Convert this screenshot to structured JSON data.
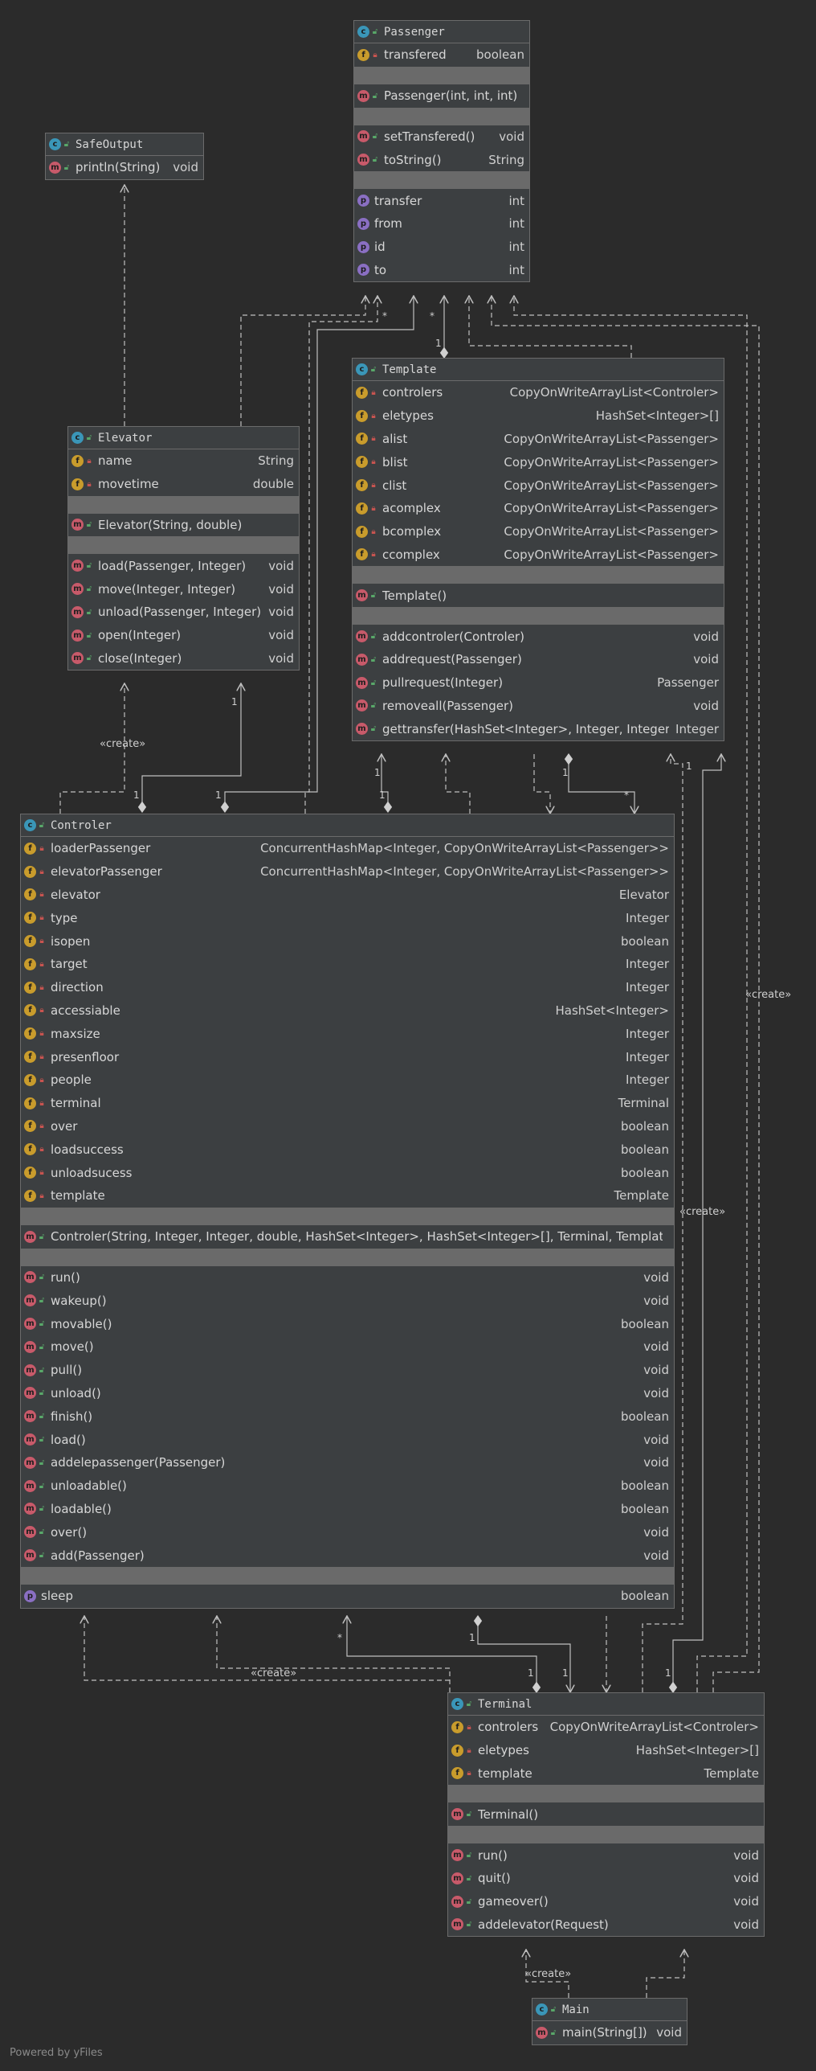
{
  "classes": {
    "passenger": {
      "name": "Passenger",
      "fields": [
        {
          "name": "transfered",
          "type": "boolean"
        }
      ],
      "constructors": [
        {
          "name": "Passenger(int, int, int)",
          "type": ""
        }
      ],
      "methods": [
        {
          "name": "setTransfered()",
          "type": "void"
        },
        {
          "name": "toString()",
          "type": "String"
        }
      ],
      "properties": [
        {
          "name": "transfer",
          "type": "int"
        },
        {
          "name": "from",
          "type": "int"
        },
        {
          "name": "id",
          "type": "int"
        },
        {
          "name": "to",
          "type": "int"
        }
      ]
    },
    "safeoutput": {
      "name": "SafeOutput",
      "methods": [
        {
          "name": "println(String)",
          "type": "void"
        }
      ]
    },
    "template": {
      "name": "Template",
      "fields": [
        {
          "name": "controlers",
          "type": "CopyOnWriteArrayList<Controler>"
        },
        {
          "name": "eletypes",
          "type": "HashSet<Integer>[]"
        },
        {
          "name": "alist",
          "type": "CopyOnWriteArrayList<Passenger>"
        },
        {
          "name": "blist",
          "type": "CopyOnWriteArrayList<Passenger>"
        },
        {
          "name": "clist",
          "type": "CopyOnWriteArrayList<Passenger>"
        },
        {
          "name": "acomplex",
          "type": "CopyOnWriteArrayList<Passenger>"
        },
        {
          "name": "bcomplex",
          "type": "CopyOnWriteArrayList<Passenger>"
        },
        {
          "name": "ccomplex",
          "type": "CopyOnWriteArrayList<Passenger>"
        }
      ],
      "constructors": [
        {
          "name": "Template()",
          "type": ""
        }
      ],
      "methods": [
        {
          "name": "addcontroler(Controler)",
          "type": "void"
        },
        {
          "name": "addrequest(Passenger)",
          "type": "void"
        },
        {
          "name": "pullrequest(Integer)",
          "type": "Passenger"
        },
        {
          "name": "removeall(Passenger)",
          "type": "void"
        },
        {
          "name": "gettransfer(HashSet<Integer>, Integer, Integer)",
          "type": "Integer"
        }
      ]
    },
    "elevator": {
      "name": "Elevator",
      "fields": [
        {
          "name": "name",
          "type": "String"
        },
        {
          "name": "movetime",
          "type": "double"
        }
      ],
      "constructors": [
        {
          "name": "Elevator(String, double)",
          "type": ""
        }
      ],
      "methods": [
        {
          "name": "load(Passenger, Integer)",
          "type": "void"
        },
        {
          "name": "move(Integer, Integer)",
          "type": "void"
        },
        {
          "name": "unload(Passenger, Integer)",
          "type": "void"
        },
        {
          "name": "open(Integer)",
          "type": "void"
        },
        {
          "name": "close(Integer)",
          "type": "void"
        }
      ]
    },
    "controler": {
      "name": "Controler",
      "fields": [
        {
          "name": "loaderPassenger",
          "type": "ConcurrentHashMap<Integer, CopyOnWriteArrayList<Passenger>>"
        },
        {
          "name": "elevatorPassenger",
          "type": "ConcurrentHashMap<Integer, CopyOnWriteArrayList<Passenger>>"
        },
        {
          "name": "elevator",
          "type": "Elevator"
        },
        {
          "name": "type",
          "type": "Integer"
        },
        {
          "name": "isopen",
          "type": "boolean"
        },
        {
          "name": "target",
          "type": "Integer"
        },
        {
          "name": "direction",
          "type": "Integer"
        },
        {
          "name": "accessiable",
          "type": "HashSet<Integer>"
        },
        {
          "name": "maxsize",
          "type": "Integer"
        },
        {
          "name": "presenfloor",
          "type": "Integer"
        },
        {
          "name": "people",
          "type": "Integer"
        },
        {
          "name": "terminal",
          "type": "Terminal"
        },
        {
          "name": "over",
          "type": "boolean"
        },
        {
          "name": "loadsuccess",
          "type": "boolean"
        },
        {
          "name": "unloadsucess",
          "type": "boolean"
        },
        {
          "name": "template",
          "type": "Template"
        }
      ],
      "constructors": [
        {
          "name": "Controler(String, Integer, Integer, double, HashSet<Integer>, HashSet<Integer>[], Terminal, Template)",
          "type": ""
        }
      ],
      "methods": [
        {
          "name": "run()",
          "type": "void"
        },
        {
          "name": "wakeup()",
          "type": "void"
        },
        {
          "name": "movable()",
          "type": "boolean"
        },
        {
          "name": "move()",
          "type": "void"
        },
        {
          "name": "pull()",
          "type": "void"
        },
        {
          "name": "unload()",
          "type": "void"
        },
        {
          "name": "finish()",
          "type": "boolean"
        },
        {
          "name": "load()",
          "type": "void"
        },
        {
          "name": "addelepassenger(Passenger)",
          "type": "void"
        },
        {
          "name": "unloadable()",
          "type": "boolean"
        },
        {
          "name": "loadable()",
          "type": "boolean"
        },
        {
          "name": "over()",
          "type": "void"
        },
        {
          "name": "add(Passenger)",
          "type": "void"
        }
      ],
      "properties": [
        {
          "name": "sleep",
          "type": "boolean"
        }
      ]
    },
    "terminal": {
      "name": "Terminal",
      "fields": [
        {
          "name": "controlers",
          "type": "CopyOnWriteArrayList<Controler>"
        },
        {
          "name": "eletypes",
          "type": "HashSet<Integer>[]"
        },
        {
          "name": "template",
          "type": "Template"
        }
      ],
      "constructors": [
        {
          "name": "Terminal()",
          "type": ""
        }
      ],
      "methods": [
        {
          "name": "run()",
          "type": "void"
        },
        {
          "name": "quit()",
          "type": "void"
        },
        {
          "name": "gameover()",
          "type": "void"
        },
        {
          "name": "addelevator(Request)",
          "type": "void"
        }
      ]
    },
    "main": {
      "name": "Main",
      "methods": [
        {
          "name": "main(String[])",
          "type": "void"
        }
      ]
    }
  },
  "labels": {
    "create": "«create»",
    "one": "1",
    "many": "*"
  },
  "footer": "Powered by yFiles",
  "colors": {
    "background": "#2b2b2b",
    "box": "#3c3f41",
    "separator": "#6a6a6a",
    "edge": "#bfbfbf",
    "class_badge": "#3a96b8",
    "field_badge": "#c99c2c",
    "method_badge": "#c85a6a",
    "property_badge": "#8a6fc3"
  }
}
